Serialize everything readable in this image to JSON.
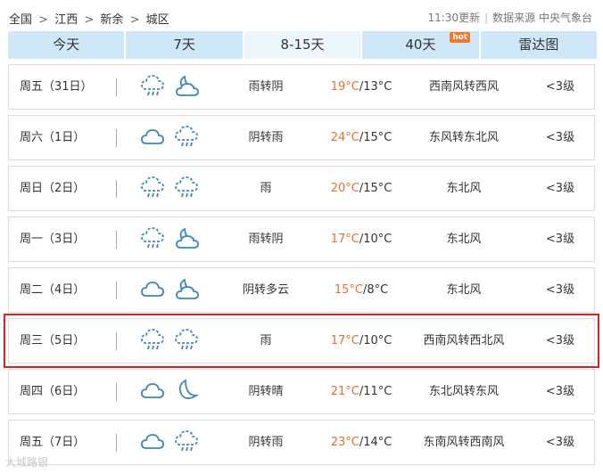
{
  "breadcrumb": [
    "全国",
    "江西",
    "新余",
    "城区"
  ],
  "breadcrumb_sep": ">",
  "update_time": "11:30更新",
  "source_label": "数据来源 中央气象台",
  "tabs": [
    {
      "label": "今天",
      "active": false
    },
    {
      "label": "7天",
      "active": false
    },
    {
      "label": "8-15天",
      "active": true
    },
    {
      "label": "40天",
      "active": false,
      "badge": "hot"
    },
    {
      "label": "雷达图",
      "active": false
    }
  ],
  "rows": [
    {
      "day": "周五（31日）",
      "icons": [
        "rain-cloud-icon",
        "moon-cloud-icon"
      ],
      "desc": "雨转阴",
      "high": "19°C",
      "low": "/13°C",
      "wind": "西南风转西风",
      "level": "<3级"
    },
    {
      "day": "周六（1日）",
      "icons": [
        "cloud-icon",
        "rain-cloud-icon"
      ],
      "desc": "阴转雨",
      "high": "24°C",
      "low": "/15°C",
      "wind": "东风转东北风",
      "level": "<3级"
    },
    {
      "day": "周日（2日）",
      "icons": [
        "rain-cloud-icon",
        "rain-cloud-icon"
      ],
      "desc": "雨",
      "high": "20°C",
      "low": "/15°C",
      "wind": "东北风",
      "level": "<3级"
    },
    {
      "day": "周一（3日）",
      "icons": [
        "rain-cloud-icon",
        "moon-cloud-icon"
      ],
      "desc": "雨转阴",
      "high": "17°C",
      "low": "/10°C",
      "wind": "东北风",
      "level": "<3级"
    },
    {
      "day": "周二（4日）",
      "icons": [
        "cloud-icon",
        "moon-cloud-icon"
      ],
      "desc": "阴转多云",
      "high": "15°C",
      "low": "/8°C",
      "wind": "东北风",
      "level": "<3级"
    },
    {
      "day": "周三（5日）",
      "icons": [
        "rain-cloud-icon",
        "rain-cloud-icon"
      ],
      "desc": "雨",
      "high": "17°C",
      "low": "/10°C",
      "wind": "西南风转西北风",
      "level": "<3级",
      "highlight": true
    },
    {
      "day": "周四（6日）",
      "icons": [
        "cloud-icon",
        "moon-icon"
      ],
      "desc": "阴转晴",
      "high": "21°C",
      "low": "/11°C",
      "wind": "东北风转东风",
      "level": "<3级"
    },
    {
      "day": "周五（7日）",
      "icons": [
        "cloud-icon",
        "rain-cloud-icon"
      ],
      "desc": "阴转雨",
      "high": "23°C",
      "low": "/14°C",
      "wind": "东南风转西南风",
      "level": "<3级"
    }
  ],
  "watermark": "大城路银"
}
